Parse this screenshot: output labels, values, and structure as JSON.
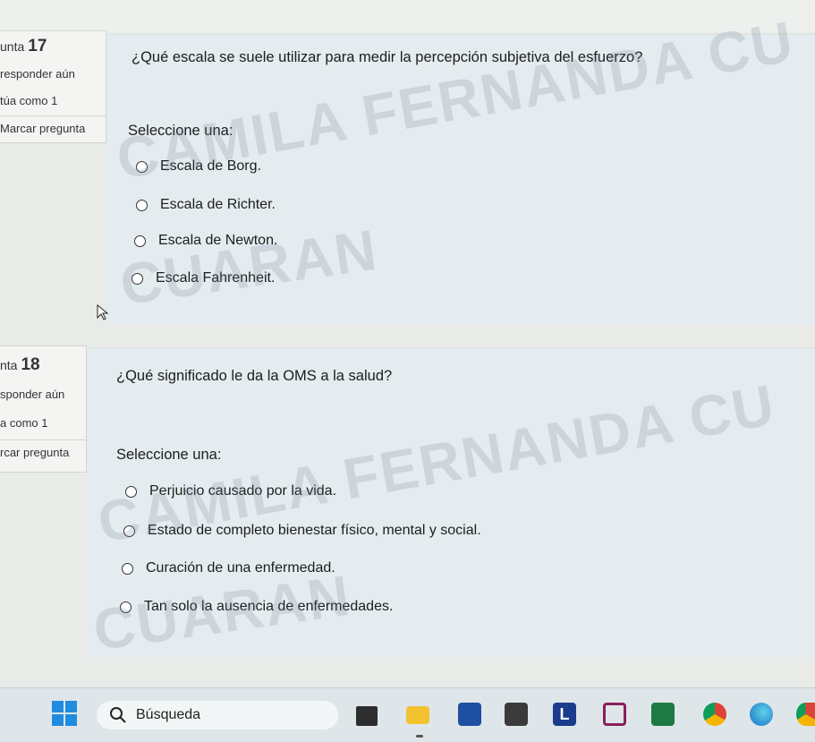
{
  "questions": [
    {
      "number_prefix": "unta",
      "number": "17",
      "status": "responder aún",
      "score": "túa como 1",
      "flag_label": "Marcar pregunta",
      "text": "¿Qué escala se suele utilizar para medir la percepción subjetiva del esfuerzo?",
      "select_label": "Seleccione una:",
      "options": [
        "Escala de Borg.",
        "Escala de Richter.",
        "Escala de Newton.",
        "Escala Fahrenheit."
      ]
    },
    {
      "number_prefix": "nta",
      "number": "18",
      "status": "sponder aún",
      "score": "a como 1",
      "flag_label": "rcar pregunta",
      "text": "¿Qué significado le da la OMS a la salud?",
      "select_label": "Seleccione una:",
      "options": [
        "Perjuicio causado por la vida.",
        "Estado de completo bienestar físico, mental y social.",
        "Curación de una enfermedad.",
        "Tan solo la ausencia de enfermedades."
      ]
    }
  ],
  "watermark": {
    "line1": "CAMILA FERNANDA CU",
    "line2": "CUARAN"
  },
  "taskbar": {
    "search_placeholder": "Búsqueda",
    "icons": [
      "windows-start-icon",
      "search-icon",
      "file-explorer-icon",
      "folder-icon",
      "word-icon",
      "store-icon",
      "app-l-icon",
      "mcafee-icon",
      "excel-icon",
      "chrome-icon",
      "edge-icon",
      "chrome-icon"
    ]
  },
  "colors": {
    "content_bg": "#e4ecf0",
    "info_bg": "#f4f5f3",
    "taskbar_bg": "#dfe6ea"
  }
}
